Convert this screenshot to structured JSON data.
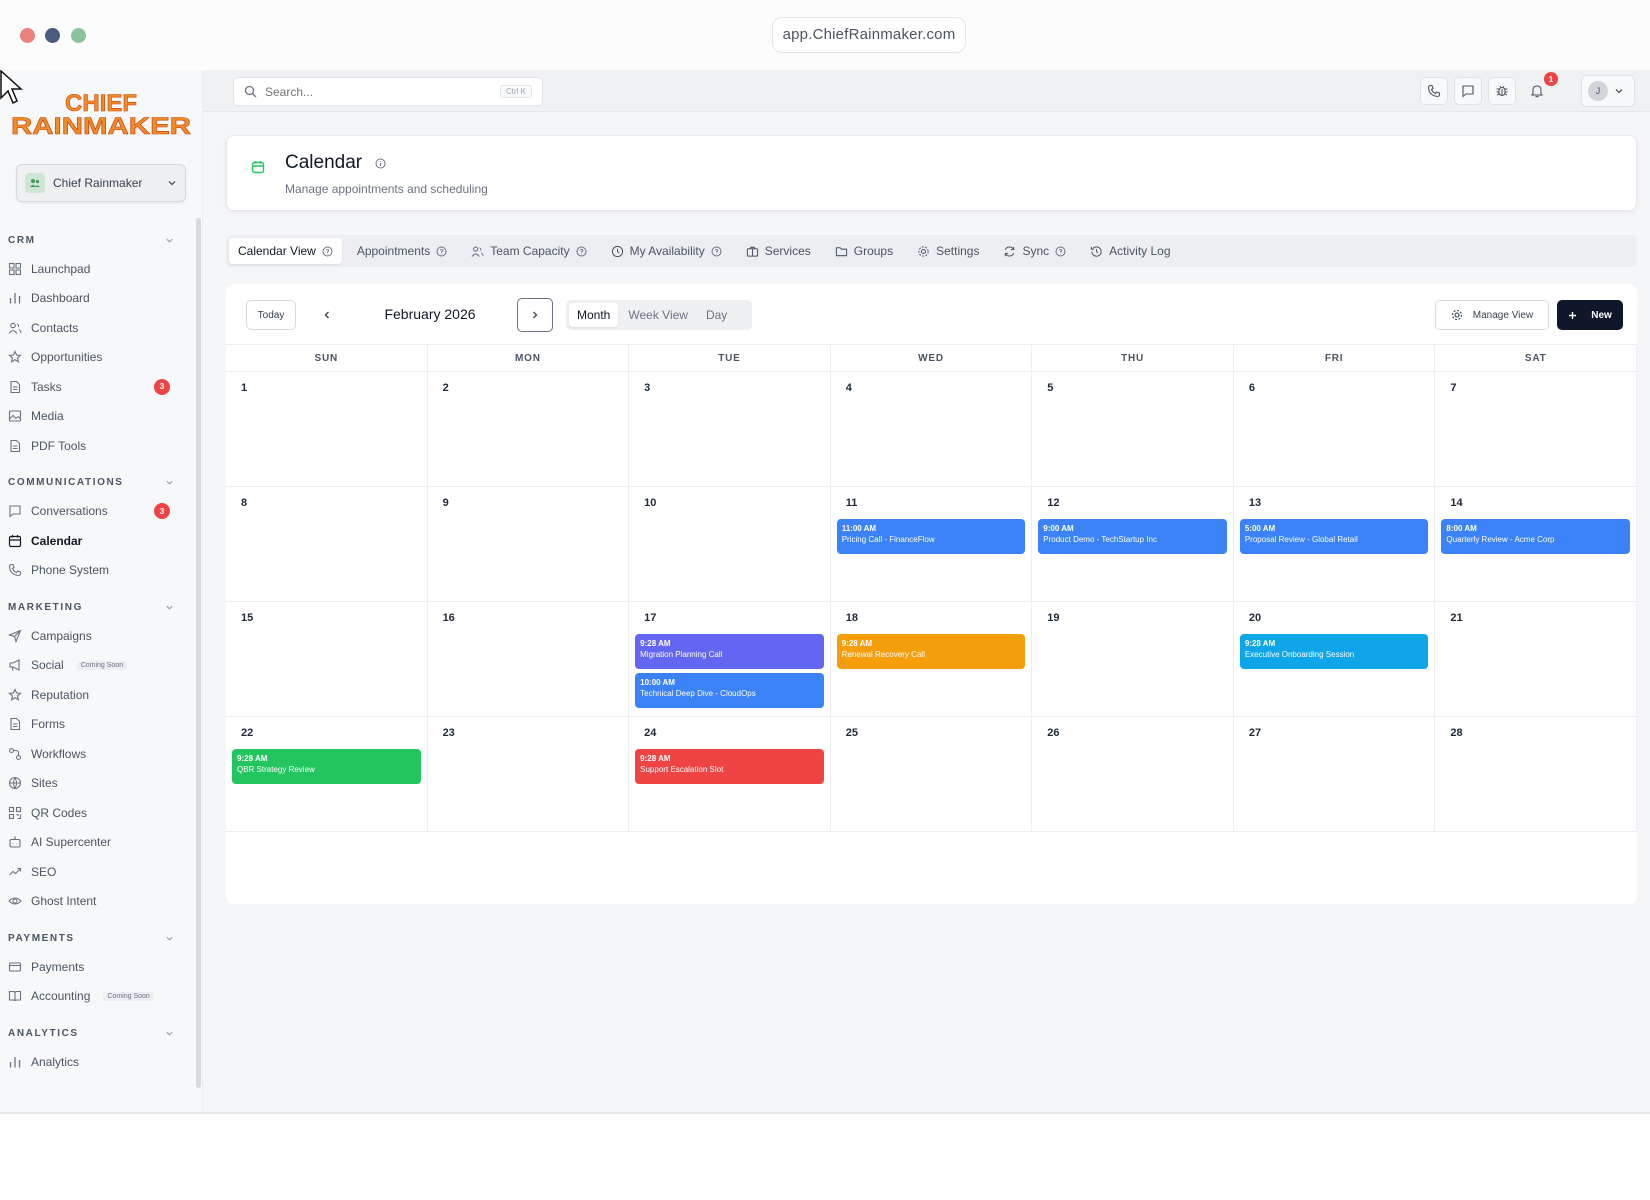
{
  "browser": {
    "url": "app.ChiefRainmaker.com"
  },
  "brand": {
    "logo_line1": "CHIEF",
    "logo_line2": "RAINMAKER",
    "logo_color": "#f28c28"
  },
  "org_switcher": {
    "label": "Chief Rainmaker"
  },
  "sidebar": {
    "sections": [
      {
        "title": "CRM",
        "items": [
          {
            "label": "Launchpad",
            "icon": "grid-icon"
          },
          {
            "label": "Dashboard",
            "icon": "bar-chart-icon"
          },
          {
            "label": "Contacts",
            "icon": "users-icon"
          },
          {
            "label": "Opportunities",
            "icon": "star-icon"
          },
          {
            "label": "Tasks",
            "icon": "document-icon",
            "badge": "3"
          },
          {
            "label": "Media",
            "icon": "image-icon"
          },
          {
            "label": "PDF Tools",
            "icon": "document-icon"
          }
        ]
      },
      {
        "title": "COMMUNICATIONS",
        "items": [
          {
            "label": "Conversations",
            "icon": "chat-icon",
            "badge": "3"
          },
          {
            "label": "Calendar",
            "icon": "calendar-icon",
            "active": true
          },
          {
            "label": "Phone System",
            "icon": "phone-icon"
          }
        ]
      },
      {
        "title": "MARKETING",
        "items": [
          {
            "label": "Campaigns",
            "icon": "send-icon"
          },
          {
            "label": "Social",
            "icon": "megaphone-icon",
            "tag": "Coming Soon"
          },
          {
            "label": "Reputation",
            "icon": "star-icon"
          },
          {
            "label": "Forms",
            "icon": "document-icon"
          },
          {
            "label": "Workflows",
            "icon": "workflow-icon"
          },
          {
            "label": "Sites",
            "icon": "globe-icon"
          },
          {
            "label": "QR Codes",
            "icon": "qr-icon"
          },
          {
            "label": "AI Supercenter",
            "icon": "robot-icon"
          },
          {
            "label": "SEO",
            "icon": "trend-icon"
          },
          {
            "label": "Ghost Intent",
            "icon": "eye-icon"
          }
        ]
      },
      {
        "title": "PAYMENTS",
        "items": [
          {
            "label": "Payments",
            "icon": "card-icon"
          },
          {
            "label": "Accounting",
            "icon": "book-icon",
            "tag": "Coming Soon"
          }
        ]
      },
      {
        "title": "ANALYTICS",
        "items": [
          {
            "label": "Analytics",
            "icon": "bar-chart-icon"
          }
        ]
      }
    ]
  },
  "topbar": {
    "search_placeholder": "Search...",
    "search_shortcut": "Ctrl K",
    "notification_count": "1",
    "user_initial": "J"
  },
  "header": {
    "title": "Calendar",
    "subtitle": "Manage appointments and scheduling"
  },
  "tabs": [
    {
      "label": "Calendar View",
      "icon": "",
      "info": true,
      "active": true
    },
    {
      "label": "Appointments",
      "icon": "",
      "info": true
    },
    {
      "label": "Team Capacity",
      "icon": "users-icon",
      "info": true
    },
    {
      "label": "My Availability",
      "icon": "clock-icon",
      "info": true
    },
    {
      "label": "Services",
      "icon": "briefcase-icon",
      "info": false
    },
    {
      "label": "Groups",
      "icon": "folder-icon",
      "info": false
    },
    {
      "label": "Settings",
      "icon": "gear-icon",
      "info": false
    },
    {
      "label": "Sync",
      "icon": "refresh-icon",
      "info": true
    },
    {
      "label": "Activity Log",
      "icon": "history-icon",
      "info": false
    }
  ],
  "toolbar": {
    "today": "Today",
    "month_label": "February 2026",
    "views": [
      "Month",
      "Week View",
      "Day"
    ],
    "active_view": "Month",
    "manage_view": "Manage View",
    "new": "New"
  },
  "weekdays": [
    "SUN",
    "MON",
    "TUE",
    "WED",
    "THU",
    "FRI",
    "SAT"
  ],
  "weeks": [
    [
      {
        "day": "1",
        "events": []
      },
      {
        "day": "2",
        "events": []
      },
      {
        "day": "3",
        "events": []
      },
      {
        "day": "4",
        "events": []
      },
      {
        "day": "5",
        "events": []
      },
      {
        "day": "6",
        "events": []
      },
      {
        "day": "7",
        "events": []
      }
    ],
    [
      {
        "day": "8",
        "events": []
      },
      {
        "day": "9",
        "events": []
      },
      {
        "day": "10",
        "events": []
      },
      {
        "day": "11",
        "events": [
          {
            "time": "11:00 AM",
            "title": "Pricing Call - FinanceFlow",
            "color": "#3b82f6"
          }
        ]
      },
      {
        "day": "12",
        "events": [
          {
            "time": "9:00 AM",
            "title": "Product Demo - TechStartup Inc",
            "color": "#3b82f6"
          }
        ]
      },
      {
        "day": "13",
        "events": [
          {
            "time": "5:00 AM",
            "title": "Proposal Review - Global Retail",
            "color": "#3b82f6"
          }
        ]
      },
      {
        "day": "14",
        "events": [
          {
            "time": "8:00 AM",
            "title": "Quarterly Review - Acme Corp",
            "color": "#3b82f6"
          }
        ]
      }
    ],
    [
      {
        "day": "15",
        "events": []
      },
      {
        "day": "16",
        "events": []
      },
      {
        "day": "17",
        "events": [
          {
            "time": "9:28 AM",
            "title": "Migration Planning Call",
            "color": "#6366f1"
          },
          {
            "time": "10:00 AM",
            "title": "Technical Deep Dive - CloudOps",
            "color": "#3b82f6"
          }
        ]
      },
      {
        "day": "18",
        "events": [
          {
            "time": "9:28 AM",
            "title": "Renewal Recovery Call",
            "color": "#f59e0b"
          }
        ]
      },
      {
        "day": "19",
        "events": []
      },
      {
        "day": "20",
        "events": [
          {
            "time": "9:28 AM",
            "title": "Executive Onboarding Session",
            "color": "#0ea5e9"
          }
        ]
      },
      {
        "day": "21",
        "events": []
      }
    ],
    [
      {
        "day": "22",
        "events": [
          {
            "time": "9:28 AM",
            "title": "QBR Strategy Review",
            "color": "#22c55e"
          }
        ]
      },
      {
        "day": "23",
        "events": []
      },
      {
        "day": "24",
        "events": [
          {
            "time": "9:28 AM",
            "title": "Support Escalation Slot",
            "color": "#ef4444"
          }
        ]
      },
      {
        "day": "25",
        "events": []
      },
      {
        "day": "26",
        "events": []
      },
      {
        "day": "27",
        "events": []
      },
      {
        "day": "28",
        "events": []
      }
    ]
  ]
}
